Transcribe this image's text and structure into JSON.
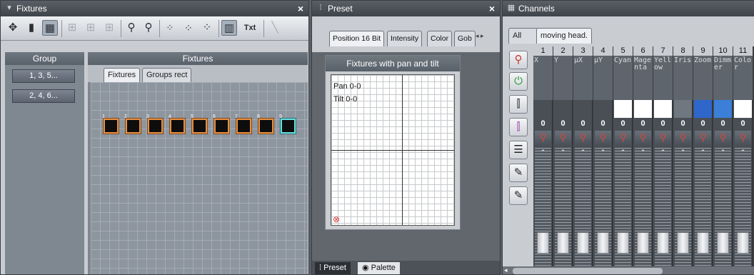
{
  "fixtures_panel": {
    "title": "Fixtures",
    "close": "×",
    "toolbar_icons": [
      "move-icon",
      "lock-icon",
      "window-select-icon",
      "add-fixture-icon",
      "add-fixture-icon-2",
      "add-fixture-icon-3",
      "zoom-in-icon",
      "zoom-out-icon",
      "dots-small-icon",
      "dots-medium-icon",
      "dots-large-icon",
      "chart-view-icon",
      "text-toggle-icon",
      "line-tool-icon"
    ],
    "txt_label": "Txt",
    "group_header": "Group",
    "groups": [
      "1, 3, 5...",
      "2, 4, 6..."
    ],
    "fixtures_header": "Fixtures",
    "tabs": [
      "Fixtures",
      "Groups rect"
    ],
    "fixtures": [
      "1",
      "2",
      "3",
      "4",
      "5",
      "6",
      "7",
      "8",
      "9"
    ],
    "colors": {
      "selected_border": "#e98f42",
      "highlight_border": "#66e0df"
    }
  },
  "preset_panel": {
    "title": "Preset",
    "close": "×",
    "tabs": [
      "Position 16 Bit",
      "Intensity",
      "Color",
      "Gob"
    ],
    "box_title": "Fixtures with pan and tilt",
    "pan": "Pan 0-0",
    "tilt": "Tilt 0-0",
    "bottom_tabs": [
      "Preset",
      "Palette"
    ]
  },
  "channels_panel": {
    "title": "Channels",
    "tabs": [
      "All",
      "moving head."
    ],
    "side_icons": [
      "intensity-knob-icon",
      "power-icon",
      "sliders-icon",
      "sliders-color-icon",
      "grid-icon",
      "palette-icon",
      "palette-edit-icon"
    ],
    "channels": [
      {
        "num": "1",
        "name": "X",
        "value": "0",
        "fill": ""
      },
      {
        "num": "2",
        "name": "Y",
        "value": "0",
        "fill": ""
      },
      {
        "num": "3",
        "name": "µX",
        "value": "0",
        "fill": ""
      },
      {
        "num": "4",
        "name": "µY",
        "value": "0",
        "fill": ""
      },
      {
        "num": "5",
        "name": "Cyan",
        "value": "0",
        "fill": "#ffffff"
      },
      {
        "num": "6",
        "name": "Magenta",
        "value": "0",
        "fill": "#ffffff"
      },
      {
        "num": "7",
        "name": "Yellow",
        "value": "0",
        "fill": "#ffffff"
      },
      {
        "num": "8",
        "name": "Iris",
        "value": "0",
        "fill": "#6f7780"
      },
      {
        "num": "9",
        "name": "Zoom",
        "value": "0",
        "fill": "#2f66c9"
      },
      {
        "num": "10",
        "name": "Dimmer",
        "value": "0",
        "fill": "#3b7fd8"
      },
      {
        "num": "11",
        "name": "Color",
        "value": "0",
        "fill": "#ffffff"
      }
    ]
  }
}
